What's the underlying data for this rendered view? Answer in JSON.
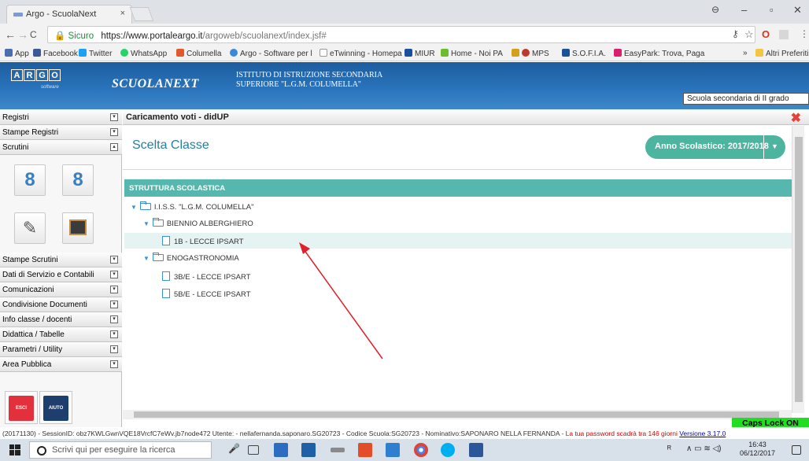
{
  "browser": {
    "tab_title": "Argo - ScuolaNext",
    "tab_close": "×",
    "win_min": "–",
    "win_max": "▫",
    "win_close": "✕",
    "back": "←",
    "forward": "→",
    "reload": "C",
    "home": "⌂",
    "secure_label": "Sicuro",
    "url_host": "https://www.portaleargo.it",
    "url_path": "/argoweb/scuolanext/index.jsf#",
    "star": "☆"
  },
  "bookmarks": [
    {
      "label": "App",
      "color": "#4a6fb0"
    },
    {
      "label": "Facebook",
      "color": "#3b5998"
    },
    {
      "label": "Twitter",
      "color": "#1da1f2"
    },
    {
      "label": "WhatsApp",
      "color": "#25d366"
    },
    {
      "label": "Columella",
      "color": "#e05a2b"
    },
    {
      "label": "Argo - Software per l",
      "color": "#3a8ad8"
    },
    {
      "label": "eTwinning - Homepa",
      "color": "#999999"
    },
    {
      "label": "MIUR",
      "color": "#1a4f9c"
    },
    {
      "label": "Home - Noi PA",
      "color": "#6bbf2f"
    },
    {
      "label": "MPS",
      "color": "#c0392b"
    },
    {
      "label": "S.O.F.I.A.",
      "color": "#1a4f9c"
    },
    {
      "label": "EasyPark: Trova, Paga",
      "color": "#d91f6e"
    },
    {
      "label": "»",
      "color": "#f2f2f2"
    },
    {
      "label": "Altri Preferiti",
      "color": "#f4c542"
    }
  ],
  "header": {
    "logo_letters": [
      "A",
      "R",
      "G",
      "O"
    ],
    "logo_sub": "software",
    "product": "SCUOLANEXT",
    "school_line1": "ISTITUTO DI ISTRUZIONE SECONDARIA",
    "school_line2": "SUPERIORE \"L.G.M. COLUMELLA\"",
    "school_type": "Scuola secondaria di II grado"
  },
  "sidebar": {
    "top_items": [
      "Registri",
      "Stampe Registri",
      "Scrutini"
    ],
    "bottom_items": [
      "Stampe Scrutini",
      "Dati di Servizio e Contabili",
      "Comunicazioni",
      "Condivisione Documenti",
      "Info classe / docenti",
      "Didattica / Tabelle",
      "Parametri / Utility",
      "Area Pubblica"
    ],
    "esci": "ESCI",
    "aiuto": "AIUTO"
  },
  "main": {
    "panel_title": "Caricamento voti - didUP",
    "close": "✖",
    "heading": "Scelta Classe",
    "anno_label": "Anno Scolastico: 2017/2018",
    "anno_caret": "▼",
    "struct_title": "STRUTTURA SCOLASTICA",
    "tree_root": "I.I.S.S. \"L.G.M. COLUMELLA\"",
    "group1": "BIENNIO ALBERGHIERO",
    "class1": "1B - LECCE IPSART",
    "group2": "ENOGASTRONOMIA",
    "class2": "3B/E - LECCE IPSART",
    "class3": "5B/E - LECCE IPSART"
  },
  "status": {
    "caps": "Caps Lock ON",
    "text": "(20171130) - SessionID: obz7KWLGwnVQE18VrcfC7eWv.jb7node472 Utente: - nellafernanda.saponaro.SG20723 - Codice Scuola:SG20723 - Nominativo:SAPONARO NELLA FERNANDA ",
    "warning": "- La tua password scadrà tra 146 giorni",
    "version": "Versione 3.17.0"
  },
  "taskbar": {
    "search_placeholder": "Scrivi qui per eseguire la ricerca",
    "time": "16:43",
    "date": "06/12/2017"
  }
}
